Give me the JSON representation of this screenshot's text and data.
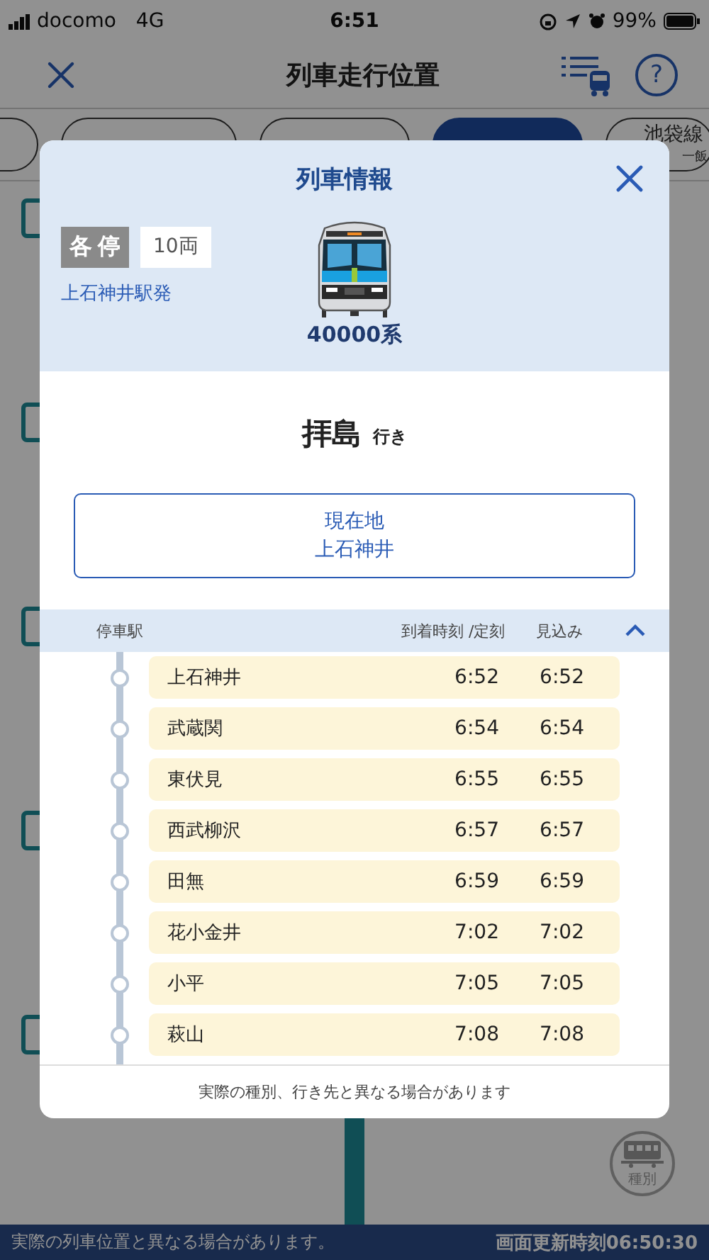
{
  "status_bar": {
    "carrier": "docomo",
    "network": "4G",
    "time": "6:51",
    "battery": "99%"
  },
  "nav": {
    "title": "列車走行位置",
    "help": "?"
  },
  "tabs": [
    {
      "selected": false
    },
    {
      "selected": false
    },
    {
      "selected": false
    },
    {
      "selected": true
    },
    {
      "selected": false,
      "label": "池袋線",
      "sublabel": "一飯"
    }
  ],
  "map": {
    "type_button": "種別"
  },
  "dialog": {
    "title": "列車情報",
    "type": "各停",
    "cars": "10両",
    "origin": "上石神井駅発",
    "series": "40000系",
    "destination": "拝島",
    "destination_suffix": "行き",
    "location_label": "現在地",
    "location": "上石神井",
    "columns": [
      "停車駅",
      "到着時刻 /定刻",
      "見込み"
    ],
    "expanded": true,
    "stops": [
      {
        "station": "上石神井",
        "scheduled": "6:52",
        "expected": "6:52"
      },
      {
        "station": "武蔵関",
        "scheduled": "6:54",
        "expected": "6:54"
      },
      {
        "station": "東伏見",
        "scheduled": "6:55",
        "expected": "6:55"
      },
      {
        "station": "西武柳沢",
        "scheduled": "6:57",
        "expected": "6:57"
      },
      {
        "station": "田無",
        "scheduled": "6:59",
        "expected": "6:59"
      },
      {
        "station": "花小金井",
        "scheduled": "7:02",
        "expected": "7:02"
      },
      {
        "station": "小平",
        "scheduled": "7:05",
        "expected": "7:05"
      },
      {
        "station": "萩山",
        "scheduled": "7:08",
        "expected": "7:08"
      }
    ],
    "note": "実際の種別、行き先と異なる場合があります"
  },
  "footer": {
    "notice": "実際の列車位置と異なる場合があります。",
    "updated": "画面更新時刻06:50:30"
  }
}
